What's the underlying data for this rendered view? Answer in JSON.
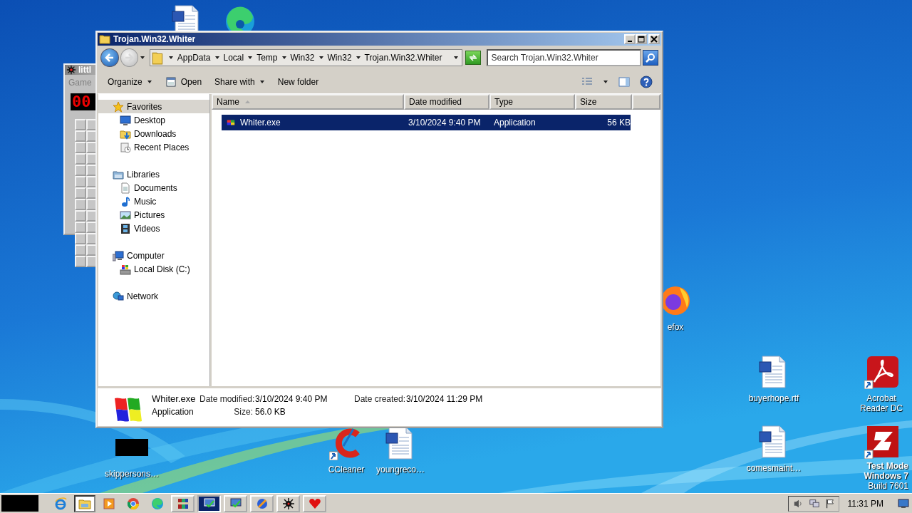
{
  "desktop": {
    "icons": [
      {
        "label": "efox"
      },
      {
        "label": "buyerhope.rtf"
      },
      {
        "label": "Acrobat Reader DC"
      },
      {
        "label": "comesmaint…"
      },
      {
        "label": "skippersons…"
      },
      {
        "label": "CCleaner"
      },
      {
        "label": "youngreco…"
      }
    ],
    "system_text": [
      "Test Mode",
      "Windows 7",
      "Build 7601"
    ]
  },
  "background_window": {
    "title": "littl",
    "menu": [
      "Game"
    ],
    "counter": "00"
  },
  "explorer": {
    "title": "Trojan.Win32.Whiter",
    "breadcrumb": [
      "AppData",
      "Local",
      "Temp",
      "Win32",
      "Win32",
      "Trojan.Win32.Whiter"
    ],
    "search": {
      "placeholder": "Search Trojan.Win32.Whiter"
    },
    "toolbar": [
      {
        "label": "Organize",
        "dropdown": true
      },
      {
        "label": "Open",
        "dropdown": false
      },
      {
        "label": "Share with",
        "dropdown": true
      },
      {
        "label": "New folder",
        "dropdown": false
      }
    ],
    "nav": [
      {
        "label": "Favorites",
        "selected": true,
        "children": [
          {
            "label": "Desktop",
            "selected": false
          },
          {
            "label": "Downloads",
            "selected": false
          },
          {
            "label": "Recent Places",
            "selected": false
          }
        ]
      },
      {
        "label": "Libraries",
        "selected": false,
        "children": [
          {
            "label": "Documents",
            "selected": false
          },
          {
            "label": "Music",
            "selected": false
          },
          {
            "label": "Pictures",
            "selected": false
          },
          {
            "label": "Videos",
            "selected": false
          }
        ]
      },
      {
        "label": "Computer",
        "selected": false,
        "children": [
          {
            "label": "Local Disk (C:)",
            "selected": false
          }
        ]
      },
      {
        "label": "Network",
        "selected": false
      }
    ],
    "columns": [
      {
        "label": "Name",
        "sorted": true
      },
      {
        "label": "Date modified",
        "sorted": false
      },
      {
        "label": "Type",
        "sorted": false
      },
      {
        "label": "Size",
        "sorted": false
      }
    ],
    "rows": [
      {
        "name": "Whiter.exe",
        "date_modified": "3/10/2024 9:40 PM",
        "type": "Application",
        "size": "56 KB",
        "selected": true
      }
    ],
    "details": {
      "name": "Whiter.exe",
      "type": "Application",
      "fields": [
        {
          "label": "Date modified:",
          "value": "3/10/2024 9:40 PM"
        },
        {
          "label": "Size:",
          "value": "56.0 KB"
        },
        {
          "label": "Date created:",
          "value": "3/10/2024 11:29 PM"
        }
      ]
    }
  },
  "taskbar": {
    "items": [
      {
        "kind": "pinned",
        "selected": false
      },
      {
        "kind": "pinned",
        "selected": true
      },
      {
        "kind": "pinned",
        "selected": false
      },
      {
        "kind": "pinned",
        "selected": false
      },
      {
        "kind": "pinned",
        "selected": false
      },
      {
        "kind": "window",
        "selected": false
      },
      {
        "kind": "window",
        "selected": true
      },
      {
        "kind": "window",
        "selected": false
      },
      {
        "kind": "window",
        "selected": false
      },
      {
        "kind": "window",
        "selected": false
      },
      {
        "kind": "window",
        "selected": false
      }
    ],
    "clock": "11:31 PM"
  }
}
